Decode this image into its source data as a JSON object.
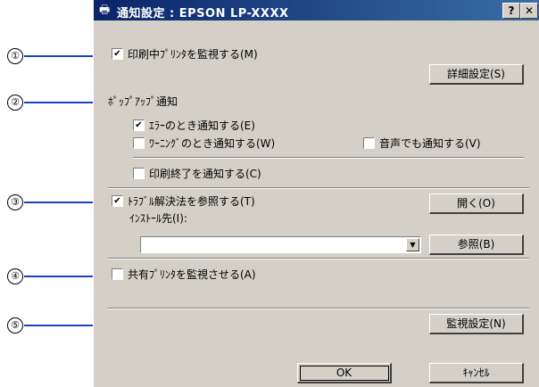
{
  "callouts": [
    "①",
    "②",
    "③",
    "④",
    "⑤"
  ],
  "window": {
    "title": "通知設定 : EPSON LP-XXXX",
    "help_btn": "?",
    "close_btn": "✕"
  },
  "monitor": {
    "label": "印刷中ﾌﾟﾘﾝﾀを監視する(M)",
    "checked": "✔"
  },
  "detail_button": "詳細設定(S)",
  "popup": {
    "heading": "ﾎﾟｯﾌﾟｱｯﾌﾟ通知",
    "error": {
      "label": "ｴﾗｰのとき通知する(E)",
      "checked": "✔"
    },
    "warning": {
      "label": "ﾜｰﾆﾝｸﾞのとき通知する(W)",
      "checked": ""
    },
    "sound": {
      "label": "音声でも通知する(V)",
      "checked": ""
    },
    "print_end": {
      "label": "印刷終了を通知する(C)",
      "checked": ""
    }
  },
  "trouble": {
    "label": "ﾄﾗﾌﾞﾙ解決法を参照する(T)",
    "checked": "✔",
    "install_label": "ｲﾝｽﾄｰﾙ先(I):",
    "install_value": "",
    "open_button": "開く(O)",
    "browse_button": "参照(B)"
  },
  "shared": {
    "label": "共有ﾌﾟﾘﾝﾀを監視させる(A)",
    "checked": ""
  },
  "monitor_settings_button": "監視設定(N)",
  "ok_button": "OK",
  "cancel_button": "ｷｬﾝｾﾙ",
  "colors": {
    "callout_line": "#1a40c8",
    "titlebar_start": "#0a246a",
    "titlebar_end": "#3a6ea5",
    "dialog_bg": "#d4d0c8"
  }
}
